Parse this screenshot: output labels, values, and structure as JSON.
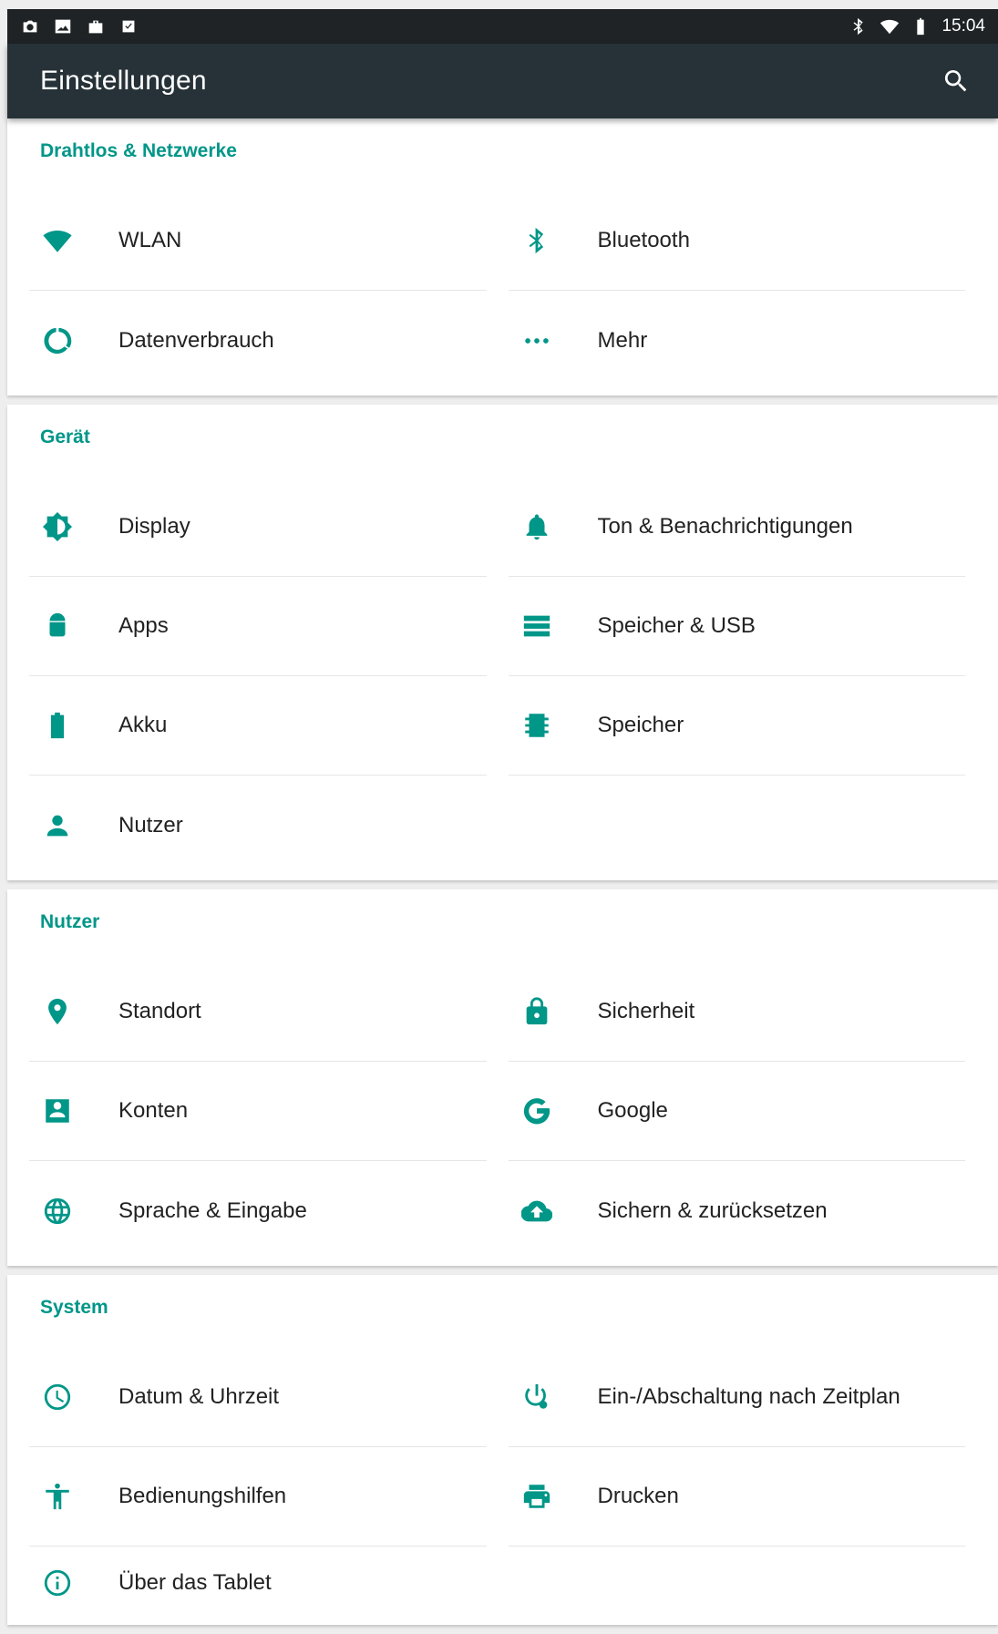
{
  "status_bar": {
    "time": "15:04"
  },
  "app_bar": {
    "title": "Einstellungen"
  },
  "sections": [
    {
      "title": "Drahtlos & Netzwerke",
      "items": [
        {
          "label": "WLAN",
          "icon": "wifi-icon"
        },
        {
          "label": "Bluetooth",
          "icon": "bluetooth-icon"
        },
        {
          "label": "Datenverbrauch",
          "icon": "data-usage-icon"
        },
        {
          "label": "Mehr",
          "icon": "more-icon"
        }
      ]
    },
    {
      "title": "Gerät",
      "items": [
        {
          "label": "Display",
          "icon": "brightness-icon"
        },
        {
          "label": "Ton & Benachrichtigungen",
          "icon": "bell-icon"
        },
        {
          "label": "Apps",
          "icon": "android-icon"
        },
        {
          "label": "Speicher & USB",
          "icon": "storage-icon"
        },
        {
          "label": "Akku",
          "icon": "battery-icon"
        },
        {
          "label": "Speicher",
          "icon": "memory-icon"
        },
        {
          "label": "Nutzer",
          "icon": "person-icon"
        }
      ]
    },
    {
      "title": "Nutzer",
      "items": [
        {
          "label": "Standort",
          "icon": "location-icon"
        },
        {
          "label": "Sicherheit",
          "icon": "lock-icon"
        },
        {
          "label": "Konten",
          "icon": "account-box-icon"
        },
        {
          "label": "Google",
          "icon": "google-icon"
        },
        {
          "label": "Sprache & Eingabe",
          "icon": "globe-icon"
        },
        {
          "label": "Sichern & zurücksetzen",
          "icon": "cloud-upload-icon"
        }
      ]
    },
    {
      "title": "System",
      "items": [
        {
          "label": "Datum & Uhrzeit",
          "icon": "clock-icon"
        },
        {
          "label": "Ein-/Abschaltung nach Zeitplan",
          "icon": "power-schedule-icon"
        },
        {
          "label": "Bedienungshilfen",
          "icon": "accessibility-icon"
        },
        {
          "label": "Drucken",
          "icon": "print-icon"
        },
        {
          "label": "Über das Tablet",
          "icon": "info-icon"
        }
      ]
    }
  ],
  "colors": {
    "accent": "#009688",
    "app_bar": "#263238",
    "status_bar": "#1f2326"
  }
}
